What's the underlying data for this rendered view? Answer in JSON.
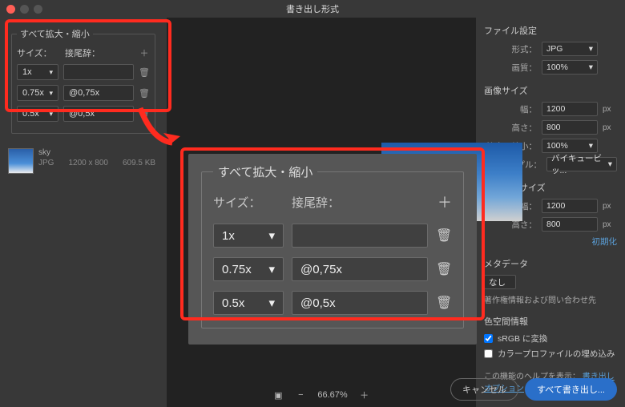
{
  "window": {
    "title": "書き出し形式"
  },
  "scale_panel": {
    "legend": "すべて拡大・縮小",
    "col_size": "サイズ：",
    "col_suffix": "接尾辞：",
    "rows": [
      {
        "size": "1x",
        "suffix": ""
      },
      {
        "size": "0.75x",
        "suffix": "@0,75x"
      },
      {
        "size": "0.5x",
        "suffix": "@0,5x"
      }
    ]
  },
  "thumb": {
    "name": "sky",
    "format": "JPG",
    "dims": "1200 x 800",
    "size": "609.5 KB"
  },
  "right": {
    "file_settings": "ファイル設定",
    "format_label": "形式：",
    "format_value": "JPG",
    "quality_label": "画質：",
    "quality_value": "100%",
    "image_size": "画像サイズ",
    "width_label": "幅：",
    "width_value": "1200",
    "height_label": "高さ：",
    "height_value": "800",
    "scale_label": "拡大・縮小：",
    "scale_value": "100%",
    "resample_label": "再サンプル：",
    "resample_value": "バイキュービッ...",
    "canvas_size": "カンバスサイズ",
    "cw_value": "1200",
    "ch_value": "800",
    "reset": "初期化",
    "metadata": "メタデータ",
    "meta_value": "なし",
    "meta_contact": "著作権情報および問い合わせ先",
    "color_space": "色空間情報",
    "srgb": "sRGB に変換",
    "embed": "カラープロファイルの埋め込み",
    "help_prefix": "この機能のヘルプを表示：",
    "help_link": "書き出しオプション",
    "px": "px"
  },
  "zoom": {
    "value": "66.67%"
  },
  "actions": {
    "cancel": "キャンセル",
    "export": "すべて書き出し..."
  },
  "icons": {
    "chev": "▾",
    "plus": "＋",
    "trash": "🗑",
    "crop": "▣",
    "minus": "−"
  }
}
